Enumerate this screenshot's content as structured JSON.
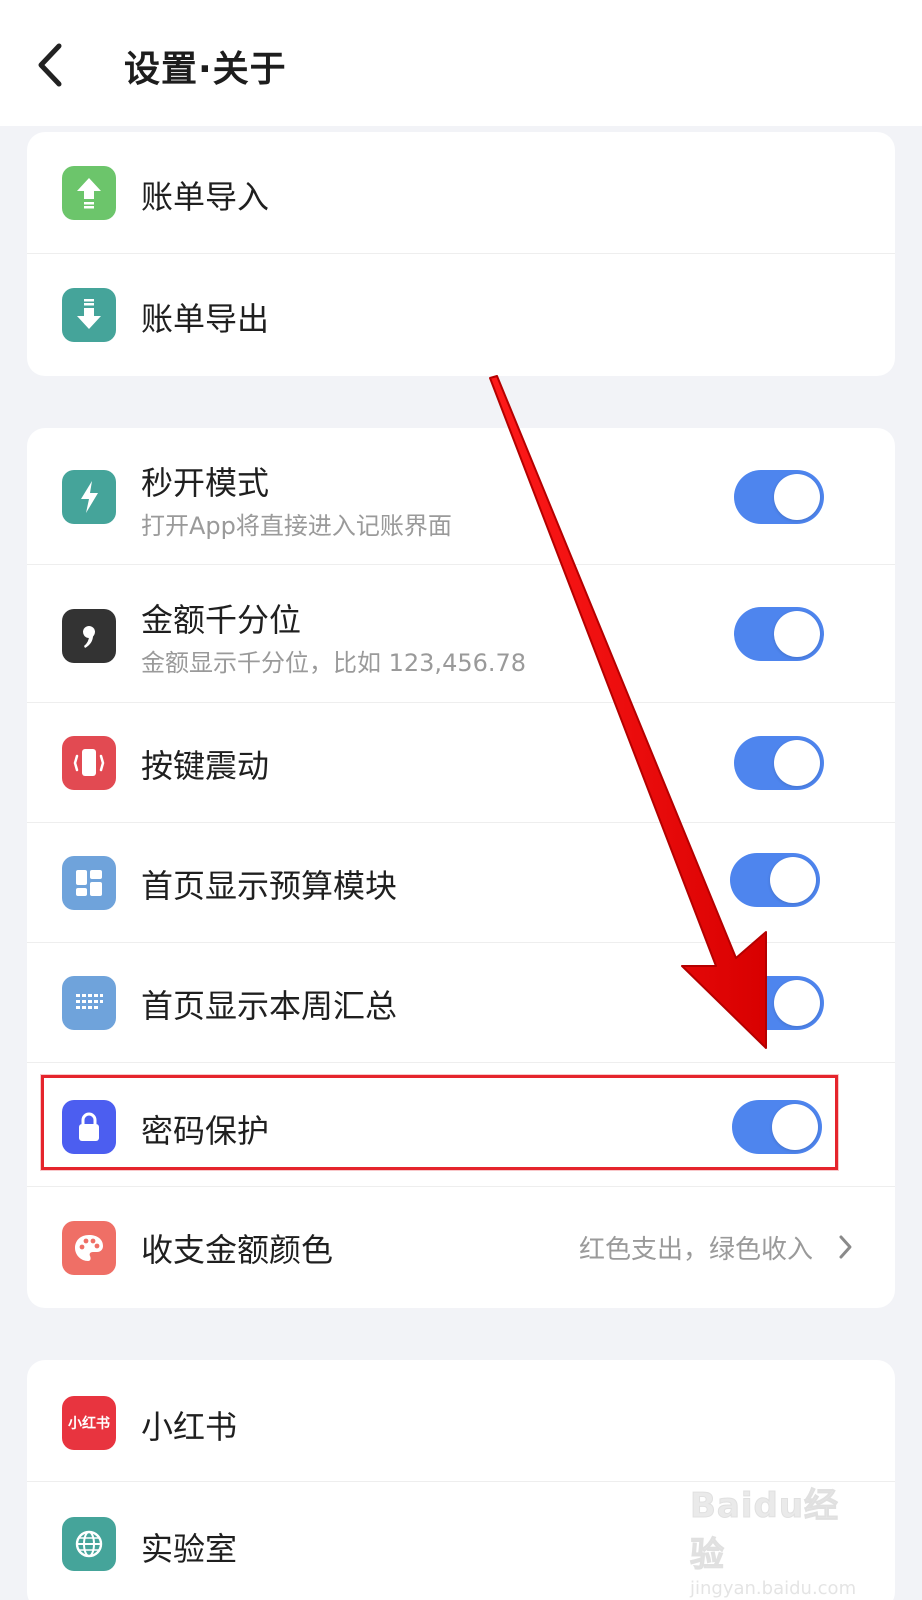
{
  "header": {
    "title": "设置·关于"
  },
  "card1": {
    "items": [
      {
        "label": "账单导入",
        "icon": "upload-icon",
        "color": "#6cc56b"
      },
      {
        "label": "账单导出",
        "icon": "download-icon",
        "color": "#45a49a"
      }
    ]
  },
  "card2": {
    "items": [
      {
        "label": "秒开模式",
        "sub": "打开App将直接进入记账界面",
        "icon": "lightning-icon",
        "color": "#45a49a",
        "toggle": true
      },
      {
        "label": "金额千分位",
        "sub": "金额显示千分位，比如 123,456.78",
        "icon": "comma-icon",
        "color": "#333333",
        "toggle": true
      },
      {
        "label": "按键震动",
        "icon": "vibrate-icon",
        "color": "#e24a52",
        "toggle": true
      },
      {
        "label": "首页显示预算模块",
        "icon": "grid-icon",
        "color": "#6fa3db",
        "toggle": true
      },
      {
        "label": "首页显示本周汇总",
        "icon": "calendar-icon",
        "color": "#6fa3db",
        "toggle": true
      },
      {
        "label": "密码保护",
        "icon": "lock-icon",
        "color": "#4c5ef0",
        "toggle": true
      },
      {
        "label": "收支金额颜色",
        "value": "红色支出，绿色收入",
        "icon": "palette-icon",
        "color": "#ef6f66"
      }
    ]
  },
  "card3": {
    "items": [
      {
        "label": "小红书",
        "icon_text": "小红书",
        "icon": "xiaohongshu-icon",
        "color": "#e8343f"
      },
      {
        "label": "实验室",
        "icon": "globe-icon",
        "color": "#45a49a"
      }
    ]
  },
  "colors": {
    "toggle_on": "#4e85ee",
    "annotation_red": "#e5242c"
  },
  "watermark": {
    "logo": "Baidu经验",
    "url": "jingyan.baidu.com"
  }
}
